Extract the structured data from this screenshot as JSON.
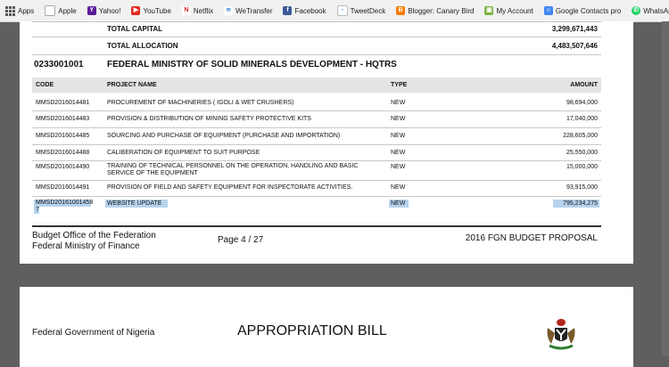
{
  "bookmarks": [
    {
      "label": "Apps",
      "icon": "apps-grid-icon",
      "color": "#555555"
    },
    {
      "label": "Apple",
      "icon": "apple-icon",
      "color": "#777777"
    },
    {
      "label": "Yahoo!",
      "icon": "yahoo-icon",
      "color": "#5c1a99"
    },
    {
      "label": "YouTube",
      "icon": "youtube-icon",
      "color": "#e02b1e"
    },
    {
      "label": "Netflix",
      "icon": "netflix-icon",
      "color": "#d1201d"
    },
    {
      "label": "WeTransfer",
      "icon": "wetransfer-icon",
      "color": "#4a90d9"
    },
    {
      "label": "Facebook",
      "icon": "facebook-icon",
      "color": "#3b5998"
    },
    {
      "label": "TweetDeck",
      "icon": "tweetdeck-icon",
      "color": "#3a8fd8"
    },
    {
      "label": "Blogger: Canary Bird",
      "icon": "blogger-icon",
      "color": "#f57d00"
    },
    {
      "label": "My Account",
      "icon": "google-account-icon",
      "color": "#7cb342"
    },
    {
      "label": "Google Contacts pro",
      "icon": "contacts-icon",
      "color": "#4285f4"
    },
    {
      "label": "WhatsApp Web",
      "icon": "whatsapp-icon",
      "color": "#25d366"
    }
  ],
  "totals": {
    "capital_label": "TOTAL CAPITAL",
    "capital_value": "3,299,671,443",
    "allocation_label": "TOTAL ALLOCATION",
    "allocation_value": "4,483,507,646"
  },
  "ministry": {
    "code": "0233001001",
    "name": "FEDERAL MINISTRY OF SOLID MINERALS DEVELOPMENT - HQTRS"
  },
  "table": {
    "headers": [
      "CODE",
      "PROJECT NAME",
      "TYPE",
      "AMOUNT"
    ],
    "rows": [
      {
        "code": "MMSD2016014481",
        "name": "PROCUREMENT OF MACHINERIES ( IGOLI & WET CRUSHERS)",
        "type": "NEW",
        "amount": "98,694,000"
      },
      {
        "code": "MMSD2016014483",
        "name": "PROVISION & DISTRIBUTION OF MINING SAFETY PROTECTIVE KITS",
        "type": "NEW",
        "amount": "17,040,000"
      },
      {
        "code": "MMSD2016014485",
        "name": "SOURCING AND PURCHASE OF EQUIPMENT (PURCHASE AND IMPORTATION)",
        "type": "NEW",
        "amount": "228,605,000"
      },
      {
        "code": "MMSD2016014488",
        "name": "CALIBERATION OF EQUIPMENT TO SUIT PURPOSE",
        "type": "NEW",
        "amount": "25,550,000"
      },
      {
        "code": "MMSD2016014490",
        "name": "TRAINING OF TECHNICAL PERSONNEL ON THE OPERATION, HANDLING AND BASIC",
        "name2": "SERVICE OF THE EQUIPMENT",
        "type": "NEW",
        "amount": "15,000,000"
      },
      {
        "code": "MMSD2016014491",
        "name": "PROVISION OF FIELD AND SAFETY EQUIPMENT FOR INSPECTORATE ACTIVITIES.",
        "type": "NEW",
        "amount": "93,915,000"
      },
      {
        "code": "MMSD20161001458",
        "code2": "7",
        "name": "WEBSITE UPDATE",
        "type": "NEW",
        "amount": "795,234,275"
      }
    ]
  },
  "footer": {
    "office_line1": "Budget Office of the Federation",
    "office_line2": "Federal Ministry of Finance",
    "page": "Page 4  /  27",
    "doc": "2016 FGN BUDGET PROPOSAL"
  },
  "page2": {
    "gov": "Federal Government of Nigeria",
    "title": "APPROPRIATION BILL",
    "emblem": "coat-of-arms-icon"
  }
}
